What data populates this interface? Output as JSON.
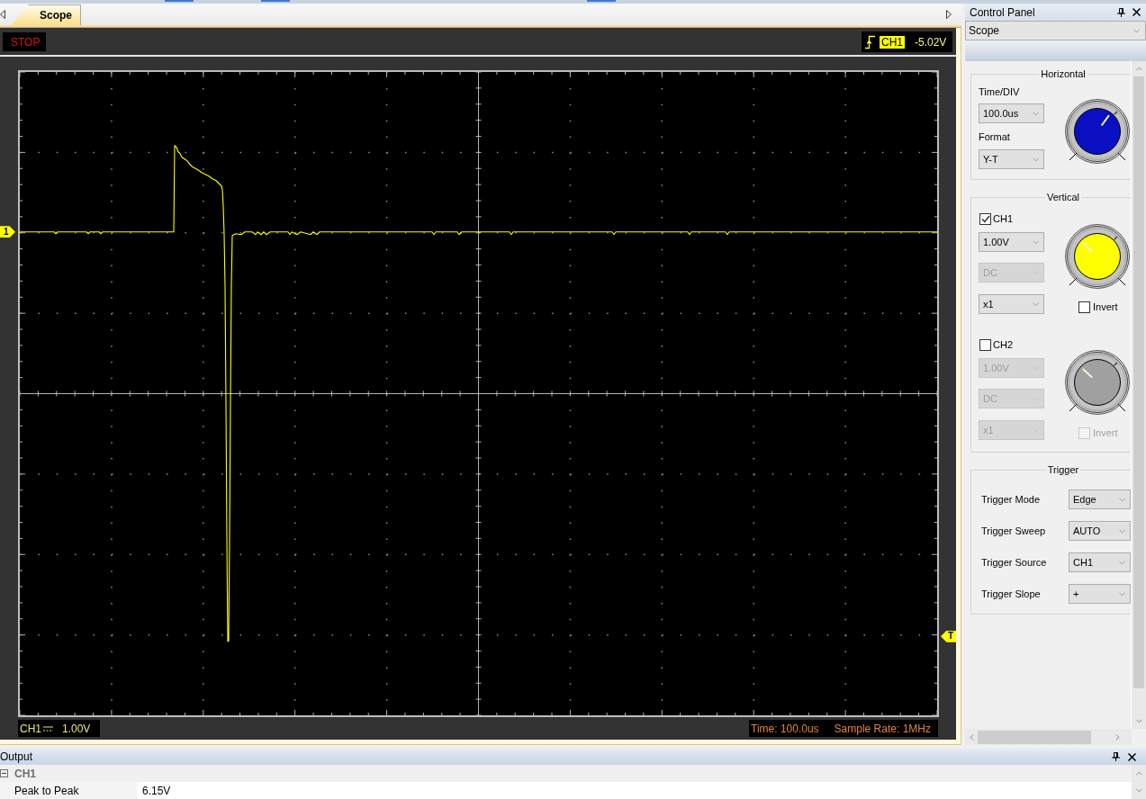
{
  "tabs": [
    {
      "label": "Scope",
      "selected": true
    }
  ],
  "scope": {
    "run_state": "STOP",
    "trigger_readout": {
      "source": "CH1",
      "level": "-5.02V"
    },
    "channel_marker": "1",
    "trigger_marker": "T",
    "channel_readout": {
      "name": "CH1",
      "scale": "1.00V"
    },
    "time_readout": "Time: 100.0us",
    "sample_rate": "Sample Rate: 1MHz"
  },
  "control_panel": {
    "title": "Control Panel",
    "view": "Scope",
    "horizontal": {
      "title": "Horizontal",
      "fields": [
        {
          "label": "Time/DIV",
          "value": "100.0us"
        },
        {
          "label": "Format",
          "value": "Y-T"
        }
      ]
    },
    "vertical": {
      "title": "Vertical",
      "channels": [
        {
          "name": "CH1",
          "checked": true,
          "color": "#ffff00",
          "selects": [
            {
              "value": "1.00V",
              "disabled": false
            },
            {
              "value": "DC",
              "disabled": true
            },
            {
              "value": "x1",
              "disabled": false
            }
          ],
          "invert": {
            "label": "Invert",
            "checked": false,
            "disabled": false
          }
        },
        {
          "name": "CH2",
          "checked": false,
          "color": "#a0a0a0",
          "selects": [
            {
              "value": "1.00V",
              "disabled": true
            },
            {
              "value": "DC",
              "disabled": true
            },
            {
              "value": "x1",
              "disabled": true
            }
          ],
          "invert": {
            "label": "Invert",
            "checked": false,
            "disabled": true
          }
        }
      ]
    },
    "trigger": {
      "title": "Trigger",
      "rows": [
        {
          "label": "Trigger Mode",
          "value": "Edge"
        },
        {
          "label": "Trigger Sweep",
          "value": "AUTO"
        },
        {
          "label": "Trigger Source",
          "value": "CH1"
        },
        {
          "label": "Trigger Slope",
          "value": "+"
        }
      ]
    }
  },
  "output": {
    "title": "Output",
    "groups": [
      {
        "name": "CH1",
        "expanded": true,
        "rows": [
          {
            "label": "Peak to Peak",
            "value": "6.15V"
          }
        ]
      }
    ]
  }
}
